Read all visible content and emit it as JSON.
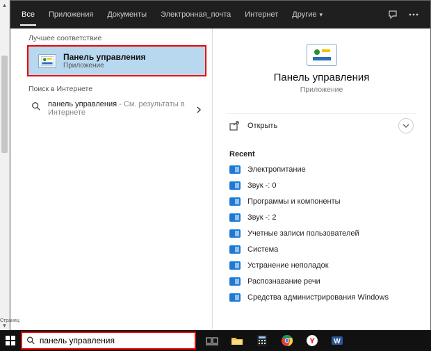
{
  "tabs": {
    "t0": "Все",
    "t1": "Приложения",
    "t2": "Документы",
    "t3": "Электронная_почта",
    "t4": "Интернет",
    "t5": "Другие"
  },
  "sections": {
    "best": "Лучшее соответствие",
    "web": "Поиск в Интернете"
  },
  "bestMatch": {
    "title": "Панель управления",
    "sub": "Приложение"
  },
  "webResult": {
    "query": "панель управления",
    "suffix": " - См. результаты в Интернете"
  },
  "preview": {
    "title": "Панель управления",
    "sub": "Приложение",
    "open": "Открыть",
    "recentLabel": "Recent"
  },
  "recent": {
    "i0": "Электропитание",
    "i1": "Звук -: 0",
    "i2": "Программы и компоненты",
    "i3": "Звук -: 2",
    "i4": "Учетные записи пользователей",
    "i5": "Система",
    "i6": "Устранение неполадок",
    "i7": "Распознавание речи",
    "i8": "Средства администрирования Windows"
  },
  "searchValue": "панель управления",
  "pageLabel": "Страниц"
}
